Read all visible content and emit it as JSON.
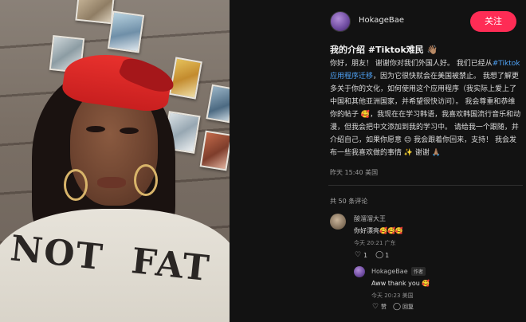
{
  "author": {
    "username": "HokageBae"
  },
  "follow_button": {
    "label": "关注"
  },
  "post": {
    "title": "我的介绍 #Tiktok难民 👋🏽",
    "body_part1": "你好，朋友！ 谢谢你对我们外国人好。 我们已经从",
    "hashtag": "#Tiktok应用程序迁移",
    "body_part2": "，因为它很快就会在美国被禁止。 我想了解更多关于你的文化，如何使用这个应用程序（我实际上爱上了中国和其他亚洲国家，并希望很快访问）。 我会尊重和恭维你的帖子 🥰，我现在在学习韩语，我喜欢韩国流行音乐和动漫，但我会把中文添加到我的学习中。 请给我一个跟随，并介绍自己，如果你愿意 😊 我会跟着你回来，支持！ 我会发布一些我喜欢做的事情 ✨ 谢谢 🙏🏽",
    "timestamp": "昨天 15:40 美国"
  },
  "comments_count": "共 50 条评论",
  "comments": [
    {
      "name": "酸溜溜大王",
      "text": "你好漂亮🥰🥰🥰",
      "meta": "今天 20:21 广东",
      "likes": "1",
      "replies": "1"
    }
  ],
  "reply": {
    "name": "HokageBae",
    "badge": "作者",
    "text": "Aww thank you 🥰",
    "meta": "今天 20:23 美国",
    "like_label": "赞",
    "reply_label": "回复"
  },
  "photo": {
    "shirt_words": [
      "NOT",
      "FAT"
    ]
  }
}
